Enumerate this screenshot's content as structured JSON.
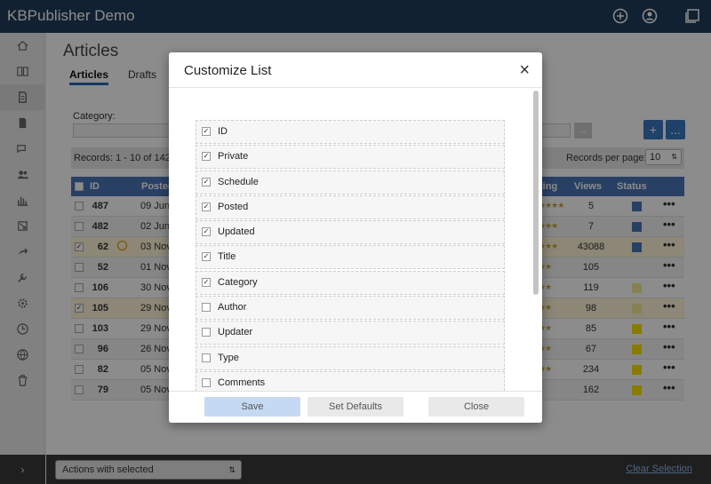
{
  "app": {
    "title": "KBPublisher Demo"
  },
  "page": {
    "title": "Articles",
    "tabs": [
      "Articles",
      "Drafts"
    ]
  },
  "filter": {
    "category_label": "Category:",
    "go_icon": "arrow-right-icon",
    "add_label": "+",
    "more_label": "..."
  },
  "records": {
    "text": "Records: 1 - 10 of 142",
    "per_page_label": "Records per page:",
    "per_page_value": "10"
  },
  "grid": {
    "headers": {
      "id": "ID",
      "posted": "Posted",
      "rating": "ting",
      "views": "Views",
      "status": "Status"
    },
    "rows": [
      {
        "id": "487",
        "date": "09 Jun,",
        "stars": "★★★★",
        "views": "5",
        "status_color": "#4b76b8",
        "checked": false,
        "highlight": false,
        "alt": false
      },
      {
        "id": "482",
        "date": "02 Jun,",
        "stars": "★★★",
        "views": "7",
        "status_color": "#4b76b8",
        "checked": false,
        "highlight": false,
        "alt": true
      },
      {
        "id": "62",
        "date": "03 Nov",
        "stars": "★★★",
        "views": "43088",
        "status_color": "#4b76b8",
        "checked": true,
        "highlight": true,
        "alt": false
      },
      {
        "id": "52",
        "date": "01 Nov",
        "stars": "★★",
        "views": "105",
        "status_color": "",
        "checked": false,
        "highlight": false,
        "alt": true
      },
      {
        "id": "106",
        "date": "30 Nov",
        "stars": "★★",
        "views": "119",
        "status_color": "#f3ec9a",
        "checked": false,
        "highlight": false,
        "alt": false
      },
      {
        "id": "105",
        "date": "29 Nov",
        "stars": "★★",
        "views": "98",
        "status_color": "#f3ec9a",
        "checked": true,
        "highlight": true,
        "alt": false
      },
      {
        "id": "103",
        "date": "29 Nov",
        "stars": "★★",
        "views": "85",
        "status_color": "#f6e000",
        "checked": false,
        "highlight": false,
        "alt": false
      },
      {
        "id": "96",
        "date": "26 Nov",
        "stars": "★★",
        "views": "67",
        "status_color": "#f6e000",
        "checked": false,
        "highlight": false,
        "alt": true
      },
      {
        "id": "82",
        "date": "05 Nov",
        "stars": "★★",
        "views": "234",
        "status_color": "#f6e000",
        "checked": false,
        "highlight": false,
        "alt": false
      },
      {
        "id": "79",
        "date": "05 Nov",
        "stars": "",
        "views": "162",
        "status_color": "#f6e000",
        "checked": false,
        "highlight": false,
        "alt": true
      }
    ],
    "row_action": "•••"
  },
  "sidebar": {
    "items": [
      "home-icon",
      "book-icon",
      "article-icon",
      "pdf-icon",
      "comments-icon",
      "users-icon",
      "chart-icon",
      "import-icon",
      "share-icon",
      "tools-icon",
      "settings-icon",
      "clock-icon",
      "globe-icon",
      "trash-icon"
    ],
    "expand": "›"
  },
  "bottombar": {
    "actions_label": "Actions with selected",
    "clear_label": "Clear Selection"
  },
  "modal": {
    "title": "Customize List",
    "close": "×",
    "columns": [
      {
        "label": "ID",
        "checked": true
      },
      {
        "label": "Private",
        "checked": true
      },
      {
        "label": "Schedule",
        "checked": true
      },
      {
        "label": "Posted",
        "checked": true
      },
      {
        "label": "Updated",
        "checked": true
      },
      {
        "label": "Title",
        "checked": true
      },
      {
        "label": "Category",
        "checked": true
      },
      {
        "label": "Author",
        "checked": false
      },
      {
        "label": "Updater",
        "checked": false
      },
      {
        "label": "Type",
        "checked": false
      },
      {
        "label": "Comments",
        "checked": false
      }
    ],
    "buttons": {
      "save": "Save",
      "defaults": "Set Defaults",
      "close": "Close"
    }
  },
  "colors": {
    "topbar": "#1f3d5c",
    "accent": "#4b76b8",
    "primary_button": "#c5daf2"
  }
}
